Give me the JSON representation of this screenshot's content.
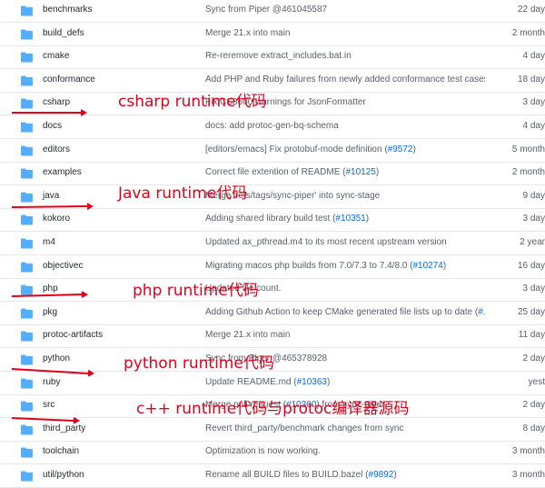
{
  "rows": [
    {
      "name": "benchmarks",
      "msg": "Sync from Piper @461045587",
      "pr": "",
      "suffix": "",
      "date": "22 day"
    },
    {
      "name": "build_defs",
      "msg": "Merge 21.x into main",
      "pr": "",
      "suffix": "",
      "date": "2 month"
    },
    {
      "name": "cmake",
      "msg": "Re-reremove extract_includes.bat.in",
      "pr": "",
      "suffix": "",
      "date": "4 day"
    },
    {
      "name": "conformance",
      "msg": "Add PHP and Ruby failures from newly added conformance test cases",
      "pr": "",
      "suffix": "",
      "date": "18 day"
    },
    {
      "name": "csharp",
      "msg": "Fix CS8600 warnings for JsonFormatter",
      "pr": "",
      "suffix": "",
      "date": "3 day"
    },
    {
      "name": "docs",
      "msg": "docs: add protoc-gen-bq-schema",
      "pr": "",
      "suffix": "",
      "date": "4 day"
    },
    {
      "name": "editors",
      "msg": "[editors/emacs] Fix protobuf-mode definition (",
      "pr": "#9572",
      "suffix": ")",
      "date": "5 month"
    },
    {
      "name": "examples",
      "msg": "Correct file extention of README (",
      "pr": "#10125",
      "suffix": ")",
      "date": "2 month"
    },
    {
      "name": "java",
      "msg": "Merge 'refs/tags/sync-piper' into sync-stage",
      "pr": "",
      "suffix": "",
      "date": "9 day"
    },
    {
      "name": "kokoro",
      "msg": "Adding shared library build test (",
      "pr": "#10351",
      "suffix": ")",
      "date": "3 day"
    },
    {
      "name": "m4",
      "msg": "Updated ax_pthread.m4 to its most recent upstream version",
      "pr": "",
      "suffix": "",
      "date": "2 year"
    },
    {
      "name": "objectivec",
      "msg": "Migrating macos php builds from 7.0/7.3 to 7.4/8.0 (",
      "pr": "#10274",
      "suffix": ")",
      "date": "16 day"
    },
    {
      "name": "php",
      "msg": "Updated file count.",
      "pr": "",
      "suffix": "",
      "date": "3 day"
    },
    {
      "name": "pkg",
      "msg": "Adding Github Action to keep CMake generated file lists up to date (",
      "pr": "#...",
      "suffix": "",
      "date": "25 day"
    },
    {
      "name": "protoc-artifacts",
      "msg": "Merge 21.x into main",
      "pr": "",
      "suffix": "",
      "date": "11 day"
    },
    {
      "name": "python",
      "msg": "Sync from Piper @465378928",
      "pr": "",
      "suffix": "",
      "date": "2 day"
    },
    {
      "name": "ruby",
      "msg": "Update README.md (",
      "pr": "#10363",
      "suffix": ")",
      "date": "yest"
    },
    {
      "name": "src",
      "msg": "Merge pull request (",
      "pr": "#10360",
      "suffix": ") from sync-piper",
      "date": "2 day"
    },
    {
      "name": "third_party",
      "msg": "Revert third_party/benchmark changes from sync",
      "pr": "",
      "suffix": "",
      "date": "8 day"
    },
    {
      "name": "toolchain",
      "msg": "Optimization is now working.",
      "pr": "",
      "suffix": "",
      "date": "3 month"
    },
    {
      "name": "util/python",
      "msg": "Rename all BUILD files to BUILD.bazel (",
      "pr": "#9892",
      "suffix": ")",
      "date": "3 month"
    }
  ],
  "annotations": [
    {
      "text": "csharp runtime代码"
    },
    {
      "text": "Java runtime代码"
    },
    {
      "text": "php runtime代码"
    },
    {
      "text": "python runtime代码"
    },
    {
      "text": "c++ runtime代码与protoc编译器源码"
    }
  ],
  "icons": {
    "folder": "folder-icon",
    "arrow": "red-arrow-icon"
  },
  "colors": {
    "folder": "#54aeff",
    "annotation": "#e2001a",
    "link": "#0969da"
  }
}
